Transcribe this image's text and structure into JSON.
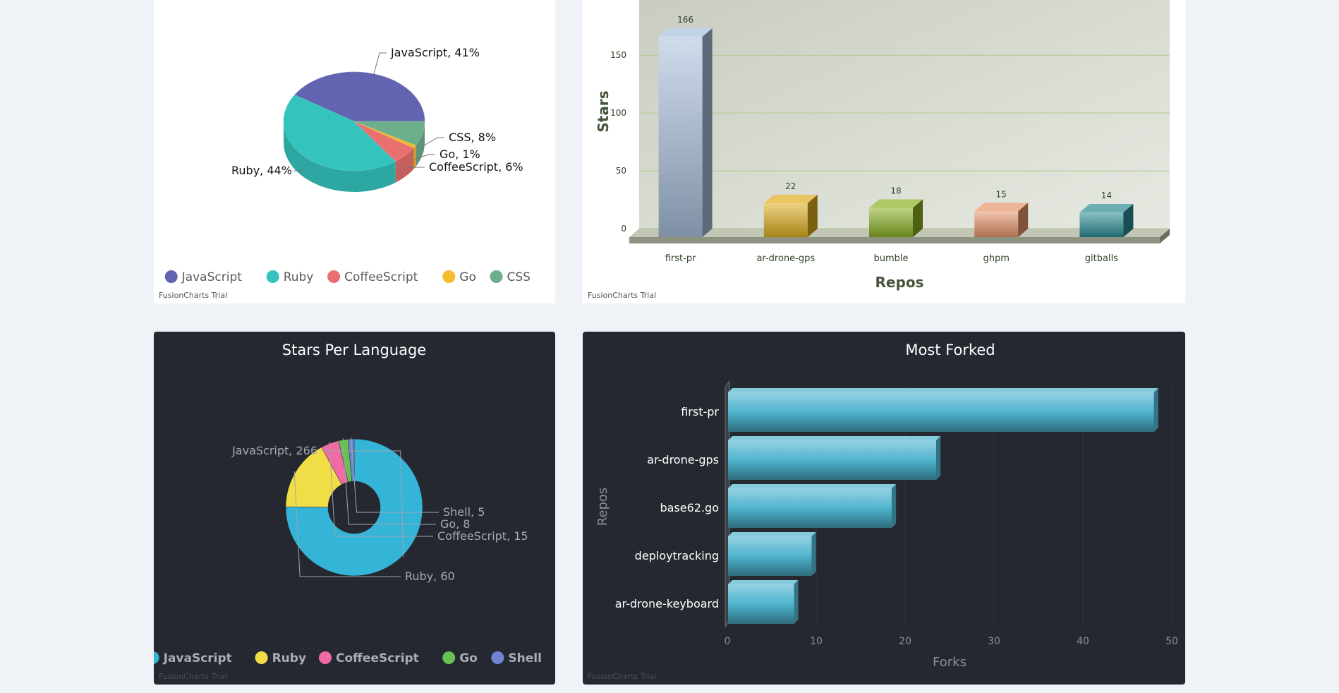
{
  "watermark": "FusionCharts Trial",
  "charts": [
    {
      "type": "pie",
      "title": "",
      "series": [
        {
          "name": "JavaScript",
          "percent": 41,
          "label": "JavaScript, 41%",
          "color": "#6264b2"
        },
        {
          "name": "Ruby",
          "percent": 44,
          "label": "Ruby, 44%",
          "color": "#34c4bd"
        },
        {
          "name": "CoffeeScript",
          "percent": 6,
          "label": "CoffeeScript, 6%",
          "color": "#e8706f"
        },
        {
          "name": "Go",
          "percent": 1,
          "label": "Go, 1%",
          "color": "#f6ba2c"
        },
        {
          "name": "CSS",
          "percent": 8,
          "label": "CSS, 8%",
          "color": "#6dae8b"
        }
      ],
      "legend_position": "bottom",
      "style": "3d"
    },
    {
      "type": "bar",
      "title": "",
      "xlabel": "Repos",
      "ylabel": "Stars",
      "categories": [
        "first-pr",
        "ar-drone-gps",
        "bumble",
        "ghpm",
        "gitballs"
      ],
      "values": [
        166,
        22,
        18,
        15,
        14
      ],
      "data_labels": [
        "166",
        "22",
        "18",
        "15",
        "14"
      ],
      "colors": [
        "#a9c0dd",
        "#dfae1e",
        "#8bb024",
        "#e8956a",
        "#2b8d95"
      ],
      "y_ticks": [
        "0",
        "50",
        "100",
        "150"
      ],
      "ylim": [
        0,
        166
      ],
      "grid": true,
      "style": "3d"
    },
    {
      "type": "pie",
      "title": "Stars Per Language",
      "series": [
        {
          "name": "JavaScript",
          "value": 266,
          "label": "JavaScript, 266",
          "color": "#34b5d8"
        },
        {
          "name": "Ruby",
          "value": 60,
          "label": "Ruby, 60",
          "color": "#f1de46"
        },
        {
          "name": "CoffeeScript",
          "value": 15,
          "label": "CoffeeScript, 15",
          "color": "#f169a5"
        },
        {
          "name": "Go",
          "value": 8,
          "label": "Go, 8",
          "color": "#67c251"
        },
        {
          "name": "Shell",
          "value": 5,
          "label": "Shell, 5",
          "color": "#6e84d3"
        }
      ],
      "legend_position": "bottom",
      "style": "doughnut"
    },
    {
      "type": "bar",
      "orientation": "horizontal",
      "title": "Most Forked",
      "xlabel": "Forks",
      "ylabel": "Repos",
      "categories": [
        "first-pr",
        "ar-drone-gps",
        "base62.go",
        "deploytracking",
        "ar-drone-keyboard"
      ],
      "values": [
        48,
        23.5,
        18.5,
        9.5,
        7.5
      ],
      "x_ticks": [
        "0",
        "10",
        "20",
        "30",
        "40",
        "50"
      ],
      "xlim": [
        0,
        50
      ],
      "grid": true,
      "color": "#4fb4cf",
      "style": "3d"
    }
  ]
}
